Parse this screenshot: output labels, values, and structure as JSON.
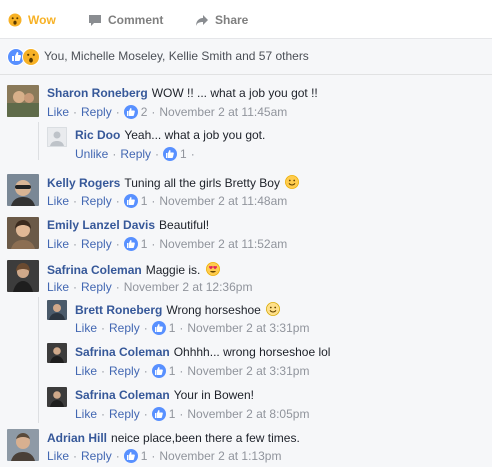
{
  "actions": {
    "wow_label": "Wow",
    "comment_label": "Comment",
    "share_label": "Share"
  },
  "reactions": {
    "summary": "You, Michelle Moseley, Kellie Smith and 57 others"
  },
  "comments": [
    {
      "name": "Sharon Roneberg",
      "text": "WOW !! ... what a job you got !!",
      "like": "Like",
      "reply": "Reply",
      "likes": "2",
      "time": "November 2 at 11:45am"
    },
    {
      "name": "Ric Doo",
      "text": "Yeah... what a job you got.",
      "like": "Unlike",
      "reply": "Reply",
      "likes": "1",
      "time": "",
      "trail": "·"
    },
    {
      "name": "Kelly Rogers",
      "text": "Tuning all the girls Bretty Boy",
      "like": "Like",
      "reply": "Reply",
      "likes": "1",
      "time": "November 2 at 11:48am"
    },
    {
      "name": "Emily Lanzel Davis",
      "text": "Beautiful!",
      "like": "Like",
      "reply": "Reply",
      "likes": "1",
      "time": "November 2 at 11:52am"
    },
    {
      "name": "Safrina Coleman",
      "text": "Maggie is.",
      "like": "Like",
      "reply": "Reply",
      "time": "November 2 at 12:36pm"
    },
    {
      "name": "Brett Roneberg",
      "text": "Wrong horseshoe",
      "like": "Like",
      "reply": "Reply",
      "likes": "1",
      "time": "November 2 at 3:31pm"
    },
    {
      "name": "Safrina Coleman",
      "text": "Ohhhh... wrong horseshoe lol",
      "like": "Like",
      "reply": "Reply",
      "likes": "1",
      "time": "November 2 at 3:31pm"
    },
    {
      "name": "Safrina Coleman",
      "text": "Your in Bowen!",
      "like": "Like",
      "reply": "Reply",
      "likes": "1",
      "time": "November 2 at 8:05pm"
    },
    {
      "name": "Adrian Hill",
      "text": "neice place,been there a few times.",
      "like": "Like",
      "reply": "Reply",
      "likes": "1",
      "time": "November 2 at 1:13pm"
    }
  ],
  "colors": {
    "link": "#365899",
    "action": "#4267b2",
    "meta": "#90949c",
    "wow": "#f7b125",
    "like_badge": "#5890ff"
  },
  "icons": {
    "wow": "wow-face-icon",
    "comment": "comment-bubble-icon",
    "share": "share-arrow-icon",
    "like": "thumbs-up-icon",
    "emoji_smile": "smile-emoji-icon",
    "emoji_hearts": "heart-eyes-emoji-icon"
  }
}
